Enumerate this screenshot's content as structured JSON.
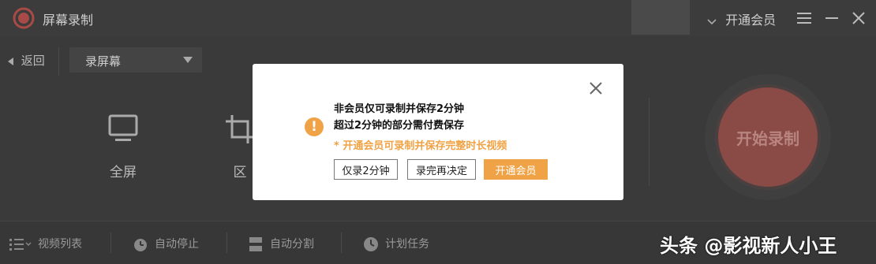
{
  "titlebar": {
    "app_title": "屏幕录制",
    "vip_label": "开通会员",
    "icons": [
      "record-logo-icon",
      "chevron-down-icon",
      "menu-icon",
      "minimize-icon",
      "close-icon"
    ]
  },
  "toolbar": {
    "back_label": "返回",
    "mode_selected": "录屏幕"
  },
  "options": [
    {
      "label": "全屏",
      "icon": "monitor-icon"
    },
    {
      "label": "区",
      "icon": "crop-icon"
    }
  ],
  "record_button_label": "开始录制",
  "bottombar": {
    "items": [
      {
        "label": "视频列表",
        "icon": "list-icon"
      },
      {
        "label": "自动停止",
        "icon": "timer-icon"
      },
      {
        "label": "自动分割",
        "icon": "split-icon"
      },
      {
        "label": "计划任务",
        "icon": "clock-icon"
      }
    ]
  },
  "watermark": "头条 @影视新人小王",
  "dialog": {
    "line1": "非会员仅可录制并保存2分钟",
    "line2": "超过2分钟的部分需付费保存",
    "tip": "* 开通会员可录制并保存完整时长视频",
    "buttons": {
      "record_2min": "仅录2分钟",
      "decide_later": "录完再决定",
      "open_vip": "开通会员"
    },
    "warning_glyph": "!"
  },
  "colors": {
    "accent_orange": "#f0a346",
    "record_red": "#8a4a45",
    "background": "#3a3a3a"
  }
}
